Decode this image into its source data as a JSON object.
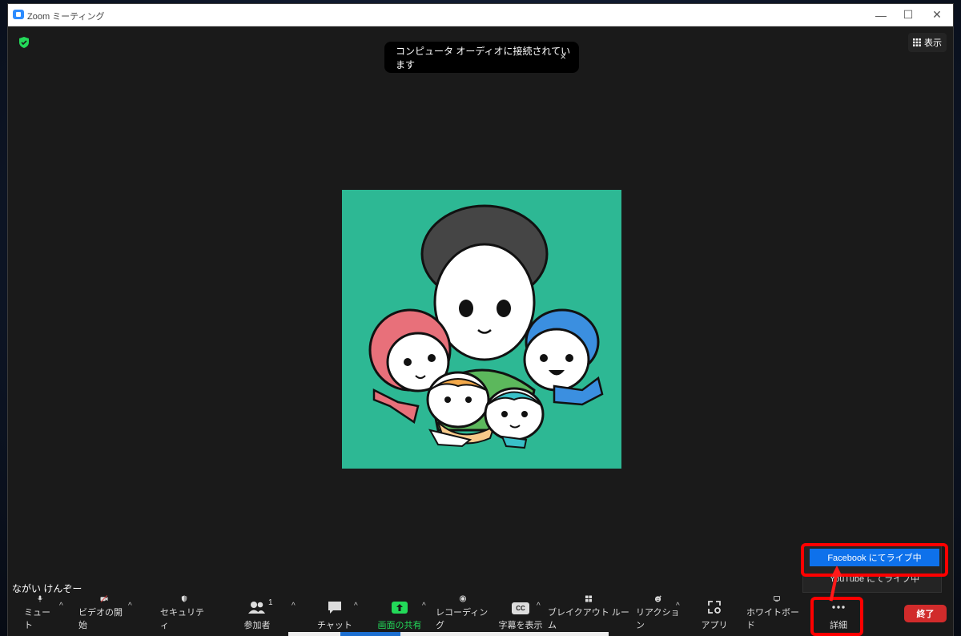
{
  "window": {
    "title": "Zoom ミーティング",
    "minimize_icon": "—",
    "maximize_icon": "☐",
    "close_icon": "✕"
  },
  "stage": {
    "view_label": "表示",
    "toast": {
      "text": "コンピュータ オーディオに接続されています",
      "close": "×"
    },
    "participant_name": "ながい けんぞー"
  },
  "toolbar": {
    "mute": "ミュート",
    "video": "ビデオの開始",
    "security": "セキュリティ",
    "participants": "参加者",
    "participants_count": "1",
    "chat": "チャット",
    "share": "画面の共有",
    "record": "レコーディング",
    "captions": "字幕を表示",
    "captions_badge": "CC",
    "breakout": "ブレイクアウト ルーム",
    "reactions": "リアクション",
    "apps": "アプリ",
    "whiteboard": "ホワイトボード",
    "more": "詳細",
    "end": "終了",
    "caret": "^"
  },
  "more_menu": {
    "items": [
      "Facebook にてライブ中",
      "YouTube にてライブ中"
    ]
  },
  "colors": {
    "share_green": "#23d959",
    "end_red": "#d12b2b",
    "menu_active_blue": "#0e71eb",
    "highlight_red": "#ff0000",
    "avatar_bg": "#2db894"
  }
}
